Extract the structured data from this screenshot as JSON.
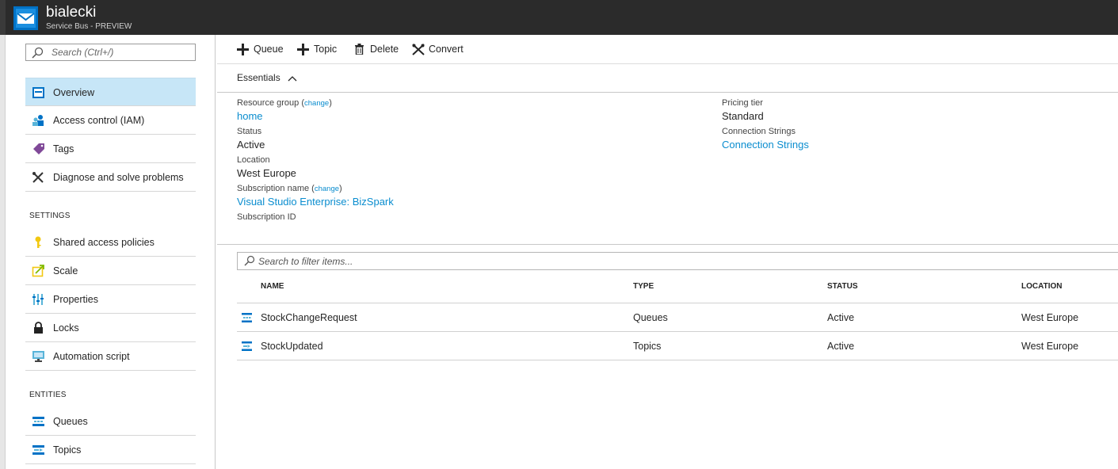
{
  "header": {
    "title": "bialecki",
    "subtitle": "Service Bus - PREVIEW",
    "icon": "service-bus-icon",
    "colors": {
      "bar": "#2b2b2b",
      "accent": "#0072c6"
    }
  },
  "sidebar": {
    "search_placeholder": "Search (Ctrl+/)",
    "items": [
      {
        "label": "Overview",
        "icon": "overview-icon",
        "active": true
      },
      {
        "label": "Access control (IAM)",
        "icon": "access-control-icon"
      },
      {
        "label": "Tags",
        "icon": "tag-icon"
      },
      {
        "label": "Diagnose and solve problems",
        "icon": "wrench-icon"
      }
    ],
    "settings_heading": "SETTINGS",
    "settings": [
      {
        "label": "Shared access policies",
        "icon": "key-icon"
      },
      {
        "label": "Scale",
        "icon": "scale-icon"
      },
      {
        "label": "Properties",
        "icon": "properties-icon"
      },
      {
        "label": "Locks",
        "icon": "lock-icon"
      },
      {
        "label": "Automation script",
        "icon": "automation-icon"
      }
    ],
    "entities_heading": "ENTITIES",
    "entities": [
      {
        "label": "Queues",
        "icon": "queue-icon"
      },
      {
        "label": "Topics",
        "icon": "topic-icon"
      }
    ]
  },
  "toolbar": {
    "queue_label": "Queue",
    "topic_label": "Topic",
    "delete_label": "Delete",
    "convert_label": "Convert"
  },
  "essentials": {
    "title": "Essentials",
    "change_label": "change",
    "resource_group_label": "Resource group",
    "resource_group_value": "home",
    "status_label": "Status",
    "status_value": "Active",
    "location_label": "Location",
    "location_value": "West Europe",
    "subscription_name_label": "Subscription name",
    "subscription_name_value": "Visual Studio Enterprise: BizSpark",
    "subscription_id_label": "Subscription ID",
    "pricing_tier_label": "Pricing tier",
    "pricing_tier_value": "Standard",
    "connection_strings_label": "Connection Strings",
    "connection_strings_value": "Connection Strings"
  },
  "filter": {
    "placeholder": "Search to filter items..."
  },
  "table": {
    "columns": [
      "NAME",
      "TYPE",
      "STATUS",
      "LOCATION"
    ],
    "rows": [
      {
        "name": "StockChangeRequest",
        "type": "Queues",
        "status": "Active",
        "location": "West Europe",
        "icon": "queue-icon"
      },
      {
        "name": "StockUpdated",
        "type": "Topics",
        "status": "Active",
        "location": "West Europe",
        "icon": "topic-icon"
      }
    ]
  }
}
